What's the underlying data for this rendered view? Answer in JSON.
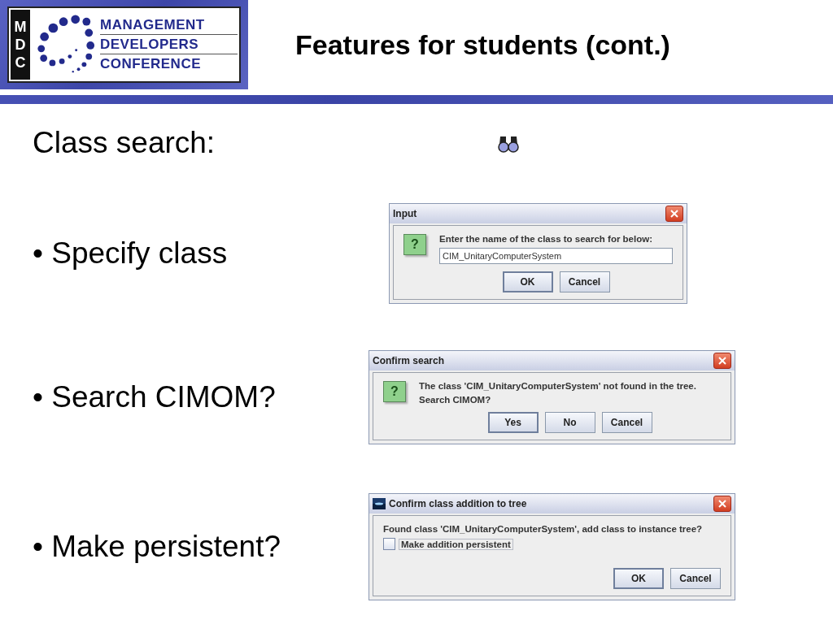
{
  "logo": {
    "letters": [
      "M",
      "D",
      "C"
    ],
    "lines": [
      "MANAGEMENT",
      "DEVELOPERS",
      "CONFERENCE"
    ]
  },
  "title": "Features for students (cont.)",
  "heading": "Class search:",
  "items": [
    {
      "bullet": "•",
      "text": "Specify class",
      "dialog": {
        "kind": "input",
        "title": "Input",
        "icon": "?",
        "message": [
          "Enter the name of the class to search for below:"
        ],
        "value": "CIM_UnitaryComputerSystem",
        "buttons": [
          {
            "label": "OK",
            "default": true
          },
          {
            "label": "Cancel",
            "default": false
          }
        ]
      }
    },
    {
      "bullet": "•",
      "text": "Search CIMOM?",
      "dialog": {
        "kind": "question",
        "title": "Confirm search",
        "icon": "?",
        "message": [
          "The class 'CIM_UnitaryComputerSystem' not found in the tree.",
          "Search CIMOM?"
        ],
        "buttons": [
          {
            "label": "Yes",
            "default": true
          },
          {
            "label": "No",
            "default": false
          },
          {
            "label": "Cancel",
            "default": false
          }
        ]
      }
    },
    {
      "bullet": "•",
      "text": "Make persistent?",
      "dialog": {
        "kind": "option",
        "title": "Confirm class addition to tree",
        "message": [
          "Found class 'CIM_UnitaryComputerSystem', add class to instance tree?"
        ],
        "checkbox": {
          "label": "Make addition persistent",
          "checked": false
        },
        "buttons": [
          {
            "label": "OK",
            "default": true
          },
          {
            "label": "Cancel",
            "default": false
          }
        ]
      }
    }
  ]
}
